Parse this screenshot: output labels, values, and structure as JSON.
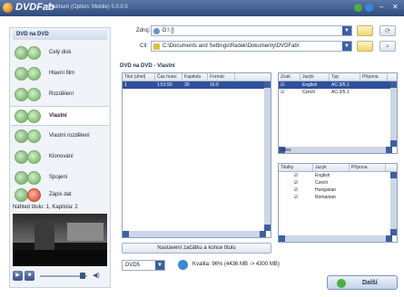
{
  "titlebar": {
    "logo": "DVDFab",
    "title": "Platinum (Option: Mobile) 5.0.0.5"
  },
  "left": {
    "header": "DVD na DVD",
    "modes": [
      {
        "label": "Celý disk",
        "icon": "disc-icon"
      },
      {
        "label": "Hlavní film",
        "icon": "disc-icon"
      },
      {
        "label": "Rozdělení",
        "icon": "disc-icon"
      },
      {
        "label": "Vlastní",
        "icon": "disc-icon",
        "active": true
      },
      {
        "label": "Vlastní rozdělení",
        "icon": "disc-icon"
      },
      {
        "label": "Klonování",
        "icon": "disc-icon"
      },
      {
        "label": "Spojení",
        "icon": "disc-icon"
      },
      {
        "label": "Zápis dat",
        "icon": "disc-burn-icon"
      }
    ],
    "preview_info": "Náhled titulu: 1, Kapitola: 2"
  },
  "source": {
    "label": "Zdroj:",
    "value": "D:\\ []"
  },
  "target": {
    "label": "Cíl:",
    "value": "C:\\Documents and Settings\\Radek\\Dokumenty\\DVDFab\\"
  },
  "section_title": "DVD na DVD - Vlastní",
  "titles_table": {
    "headers": [
      "Titul (úhel)",
      "Čas hraní",
      "Kapitola",
      "Formát"
    ],
    "rows": [
      [
        "1",
        "1:51:50",
        "30",
        "16:9"
      ]
    ]
  },
  "audio_table": {
    "headers": [
      "Zvuk",
      "Jazyk",
      "Typ",
      "Přípona"
    ],
    "rows": [
      {
        "lang": "English",
        "type": "AC-3/5.1",
        "checked": true,
        "selected": true
      },
      {
        "lang": "Czech",
        "type": "AC-3/5.1",
        "checked": true,
        "selected": false
      }
    ],
    "footer": "Video"
  },
  "subs_table": {
    "headers": [
      "Titulky",
      "Jazyk",
      "Přípona"
    ],
    "rows": [
      "English",
      "Czech",
      "Hungarian",
      "Romanian"
    ]
  },
  "reset_label": "Nastavení začátku a konce titulu",
  "output": {
    "format": "DVD5",
    "quality_label": "Kvalita: 96% (4436 MB -> 4300 MB)"
  },
  "next_label": "Další"
}
